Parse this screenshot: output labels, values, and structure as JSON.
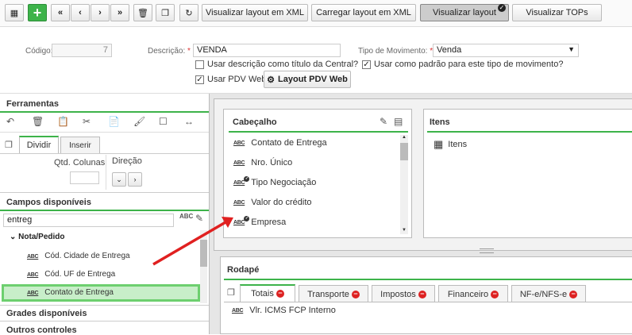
{
  "toolbar": {
    "btn_xml_view": "Visualizar layout em XML",
    "btn_xml_load": "Carregar layout em XML",
    "btn_layout_view": "Visualizar layout",
    "btn_tops": "Visualizar TOPs"
  },
  "form": {
    "codigo_label": "Código:",
    "codigo_value": "7",
    "descricao_label": "Descrição:",
    "descricao_value": "VENDA",
    "tipo_label": "Tipo de Movimento:",
    "tipo_value": "Venda",
    "chk_usar_desc": "Usar descrição como título da Central?",
    "chk_usar_padrao": "Usar como padrão para este tipo de movimento?",
    "chk_pdv": "Usar PDV Web",
    "btn_layout_pdv": "Layout PDV Web"
  },
  "sidebar": {
    "ferramentas_title": "Ferramentas",
    "tab_dividir": "Dividir",
    "tab_inserir": "Inserir",
    "qtd_colunas": "Qtd. Colunas",
    "direcao": "Direção",
    "campos_title": "Campos disponíveis",
    "search_value": "entreg",
    "group": "Nota/Pedido",
    "fields": [
      "Cód. Cidade de Entrega",
      "Cód. UF de Entrega",
      "Contato de Entrega"
    ],
    "grades_title": "Grades disponíveis",
    "outros_title": "Outros controles"
  },
  "cabecalho": {
    "title": "Cabeçalho",
    "items": [
      "Contato de Entrega",
      "Nro. Único",
      "Tipo Negociação",
      "Valor do crédito",
      "Empresa"
    ]
  },
  "itens": {
    "title": "Itens",
    "item": "Itens"
  },
  "rodape": {
    "title": "Rodapé",
    "tabs": [
      "Totais",
      "Transporte",
      "Impostos",
      "Financeiro",
      "NF-e/NFS-e"
    ],
    "row": "Vlr. ICMS FCP Interno"
  },
  "colors": {
    "accent": "#3db34a",
    "arrow": "#e02020",
    "remove": "#dd2222"
  }
}
